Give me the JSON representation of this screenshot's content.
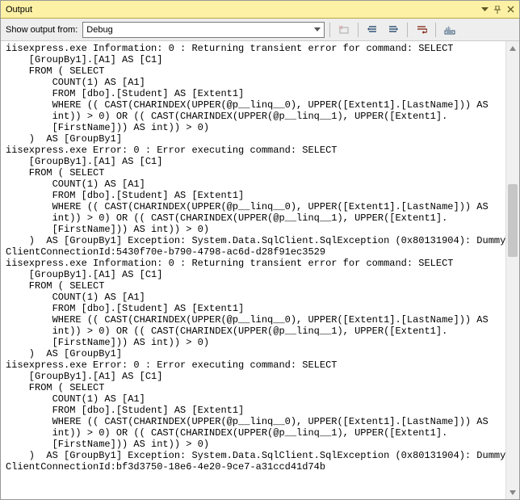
{
  "window": {
    "title": "Output",
    "dropdown_icon_name": "dropdown-arrow-icon",
    "pin_icon_name": "pin-icon",
    "close_icon_name": "close-icon"
  },
  "toolbar": {
    "label": "Show output from:",
    "selected": "Debug",
    "btn_clear": "clear-all-icon",
    "btn_indent_left": "left-indent-icon",
    "btn_indent_right": "right-indent-icon",
    "btn_wordwrap": "word-wrap-icon",
    "btn_settings": "settings-icon"
  },
  "log_lines": [
    "iisexpress.exe Information: 0 : Returning transient error for command: SELECT ",
    "    [GroupBy1].[A1] AS [C1]",
    "    FROM ( SELECT ",
    "        COUNT(1) AS [A1]",
    "        FROM [dbo].[Student] AS [Extent1]",
    "        WHERE (( CAST(CHARINDEX(UPPER(@p__linq__0), UPPER([Extent1].[LastName])) AS",
    "        int)) > 0) OR (( CAST(CHARINDEX(UPPER(@p__linq__1), UPPER([Extent1].",
    "        [FirstName])) AS int)) > 0)",
    "    )  AS [GroupBy1]",
    "iisexpress.exe Error: 0 : Error executing command: SELECT ",
    "    [GroupBy1].[A1] AS [C1]",
    "    FROM ( SELECT ",
    "        COUNT(1) AS [A1]",
    "        FROM [dbo].[Student] AS [Extent1]",
    "        WHERE (( CAST(CHARINDEX(UPPER(@p__linq__0), UPPER([Extent1].[LastName])) AS",
    "        int)) > 0) OR (( CAST(CHARINDEX(UPPER(@p__linq__1), UPPER([Extent1].",
    "        [FirstName])) AS int)) > 0)",
    "    )  AS [GroupBy1] Exception: System.Data.SqlClient.SqlException (0x80131904): Dummy",
    "ClientConnectionId:5430f70e-b790-4798-ac6d-d28f91ec3529",
    "iisexpress.exe Information: 0 : Returning transient error for command: SELECT ",
    "    [GroupBy1].[A1] AS [C1]",
    "    FROM ( SELECT ",
    "        COUNT(1) AS [A1]",
    "        FROM [dbo].[Student] AS [Extent1]",
    "        WHERE (( CAST(CHARINDEX(UPPER(@p__linq__0), UPPER([Extent1].[LastName])) AS",
    "        int)) > 0) OR (( CAST(CHARINDEX(UPPER(@p__linq__1), UPPER([Extent1].",
    "        [FirstName])) AS int)) > 0)",
    "    )  AS [GroupBy1]",
    "iisexpress.exe Error: 0 : Error executing command: SELECT ",
    "    [GroupBy1].[A1] AS [C1]",
    "    FROM ( SELECT ",
    "        COUNT(1) AS [A1]",
    "        FROM [dbo].[Student] AS [Extent1]",
    "        WHERE (( CAST(CHARINDEX(UPPER(@p__linq__0), UPPER([Extent1].[LastName])) AS",
    "        int)) > 0) OR (( CAST(CHARINDEX(UPPER(@p__linq__1), UPPER([Extent1].",
    "        [FirstName])) AS int)) > 0)",
    "    )  AS [GroupBy1] Exception: System.Data.SqlClient.SqlException (0x80131904): Dummy",
    "ClientConnectionId:bf3d3750-18e6-4e20-9ce7-a31ccd41d74b"
  ]
}
